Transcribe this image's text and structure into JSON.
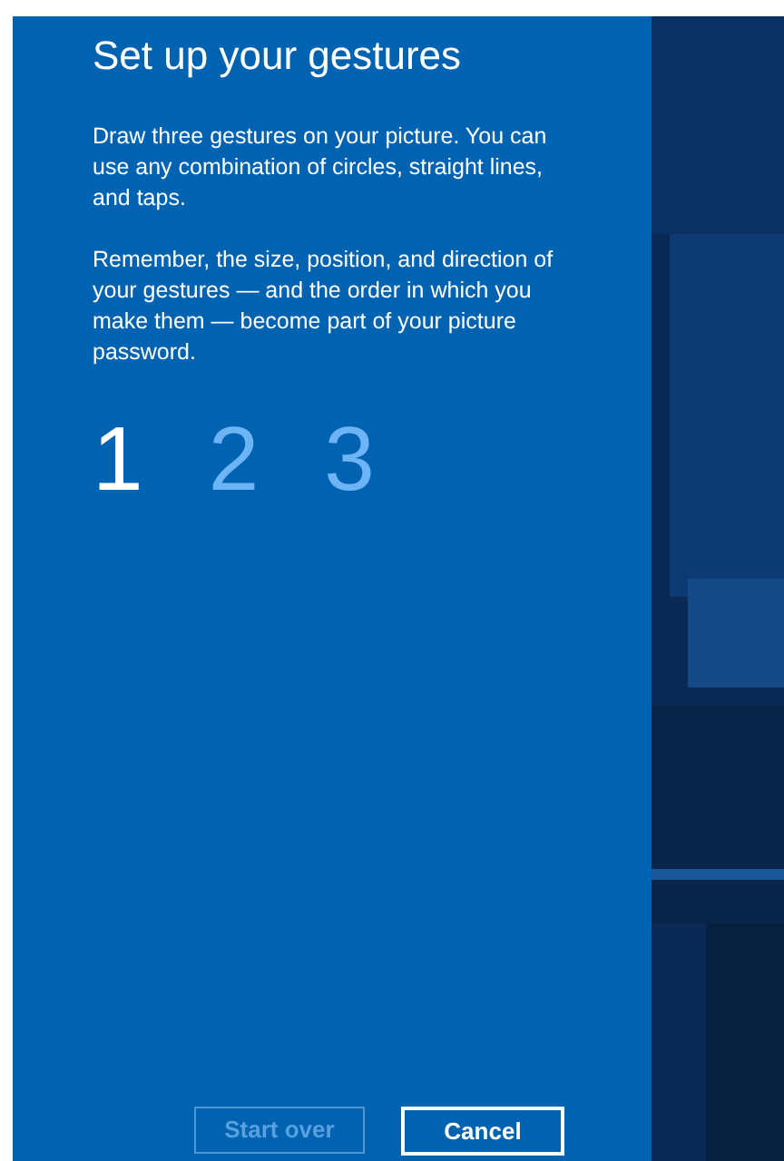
{
  "title": "Set up your gestures",
  "paragraphs": [
    "Draw three gestures on your picture. You can use any combination of circles, straight lines, and taps.",
    "Remember, the size, position, and direction of your gestures — and the order in which you make them — become part of your picture password."
  ],
  "steps": [
    {
      "label": "1",
      "selected": true
    },
    {
      "label": "2",
      "selected": false
    },
    {
      "label": "3",
      "selected": false
    }
  ],
  "buttons": [
    {
      "label": "Start over",
      "disabled": true
    },
    {
      "label": "Cancel",
      "disabled": false
    }
  ]
}
